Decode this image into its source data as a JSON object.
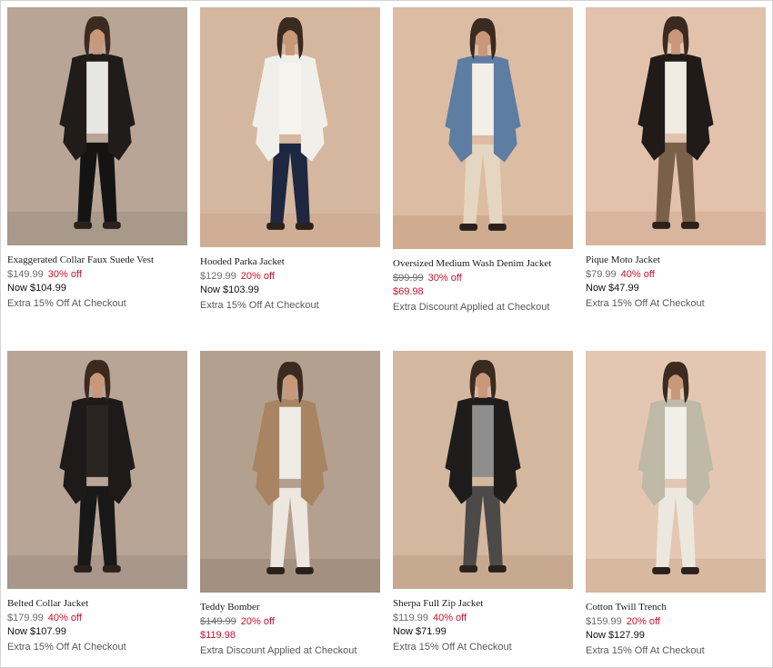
{
  "products": [
    {
      "name": "Exaggerated Collar Faux Suede Vest",
      "orig": "$149.99",
      "pct": "30% off",
      "now": "Now $104.99",
      "promo": "Extra 15% Off At Checkout",
      "image_alt": "woman-in-black-long-vest",
      "wall": "#b8a595",
      "floor": "#a9998b",
      "coat": "#1f1c1a",
      "pants": "#151414",
      "shirt": "#e8e6e2"
    },
    {
      "name": "Hooded Parka Jacket",
      "orig": "$129.99",
      "pct": "20% off",
      "now": "Now $103.99",
      "promo": "Extra 15% Off At Checkout",
      "image_alt": "woman-in-white-parka-navy-shorts",
      "wall": "#d5b79f",
      "floor": "#cfae95",
      "coat": "#f1efe9",
      "pants": "#1d2740",
      "shirt": "#f5f4ef"
    },
    {
      "name": "Oversized Medium Wash Denim Jacket",
      "orig": "$99.99",
      "pct": "30% off",
      "now": "$69.98",
      "promo": "Extra Discount Applied at Checkout",
      "image_alt": "woman-in-denim-jacket-by-suitcases",
      "wall": "#dcbca2",
      "floor": "#cfac90",
      "coat": "#5d7da3",
      "pants": "#e4d6c0",
      "shirt": "#f4efe6"
    },
    {
      "name": "Pique Moto Jacket",
      "orig": "$79.99",
      "pct": "40% off",
      "now": "Now $47.99",
      "promo": "Extra 15% Off At Checkout",
      "image_alt": "woman-in-black-moto-jacket-cargo-pants",
      "wall": "#e2c2ad",
      "floor": "#d8b59c",
      "coat": "#201b19",
      "pants": "#7a6048",
      "shirt": "#f0ebe3"
    },
    {
      "name": "Belted Collar Jacket",
      "orig": "$179.99",
      "pct": "40% off",
      "now": "Now $107.99",
      "promo": "Extra 15% Off At Checkout",
      "image_alt": "woman-in-black-belted-jacket",
      "wall": "#b9a596",
      "floor": "#a8978a",
      "coat": "#1d1a19",
      "pants": "#191818",
      "shirt": "#2a2522"
    },
    {
      "name": "Teddy Bomber",
      "orig": "$149.99",
      "pct": "20% off",
      "now": "$119.98",
      "promo": "Extra Discount Applied at Checkout",
      "image_alt": "woman-in-teddy-bomber-with-scarf",
      "wall": "#b4a08e",
      "floor": "#a39080",
      "coat": "#a88463",
      "pants": "#ece8e0",
      "shirt": "#efece6"
    },
    {
      "name": "Sherpa Full Zip Jacket",
      "orig": "$119.99",
      "pct": "40% off",
      "now": "Now $71.99",
      "promo": "Extra 15% Off At Checkout",
      "image_alt": "woman-in-black-sherpa-jacket-plaid-scarf",
      "wall": "#d3b79f",
      "floor": "#c7a98f",
      "coat": "#1f1d1c",
      "pants": "#4c4a48",
      "shirt": "#8e8e8e"
    },
    {
      "name": "Cotton Twill Trench",
      "orig": "$159.99",
      "pct": "20% off",
      "now": "Now $127.99",
      "promo": "Extra 15% Off At Checkout",
      "image_alt": "woman-in-light-trench-coat",
      "wall": "#e4c7b2",
      "floor": "#d8b89f",
      "coat": "#bfb9a7",
      "pants": "#ece8df",
      "shirt": "#f2efe9"
    }
  ]
}
